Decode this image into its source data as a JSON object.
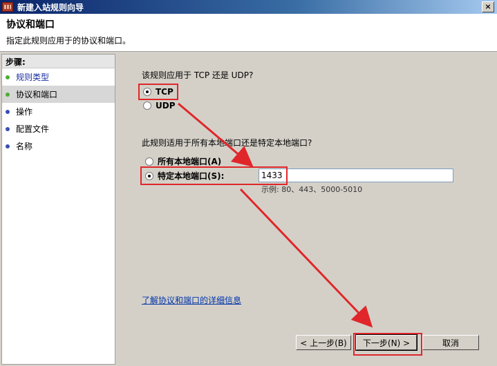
{
  "window": {
    "title": "新建入站规则向导",
    "close_glyph": "×"
  },
  "header": {
    "title": "协议和端口",
    "subtitle": "指定此规则应用于的协议和端口。"
  },
  "sidebar": {
    "heading": "步骤:",
    "items": [
      {
        "label": "规则类型"
      },
      {
        "label": "协议和端口"
      },
      {
        "label": "操作"
      },
      {
        "label": "配置文件"
      },
      {
        "label": "名称"
      }
    ]
  },
  "protocol": {
    "question": "该规则应用于 TCP 还是 UDP?",
    "tcp_label": "TCP",
    "udp_label": "UDP",
    "selected": "TCP"
  },
  "ports": {
    "question": "此规则适用于所有本地端口还是特定本地端口?",
    "all_label": "所有本地端口(A)",
    "specific_label": "特定本地端口(S):",
    "selected": "specific",
    "value": "1433",
    "example": "示例: 80、443、5000-5010"
  },
  "link": {
    "label": "了解协议和端口的详细信息"
  },
  "buttons": {
    "back": "< 上一步(B)",
    "next": "下一步(N) >",
    "cancel": "取消"
  },
  "colors": {
    "highlight": "#e0262a",
    "title_bar": "#0a246a",
    "link": "#0033aa"
  }
}
